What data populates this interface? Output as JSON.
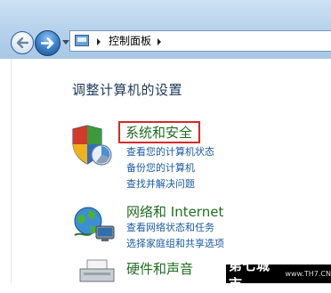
{
  "address_bar": {
    "root_label": "控制面板",
    "icon": "control-panel-icon"
  },
  "nav": {
    "back_icon": "back-arrow-icon",
    "forward_icon": "forward-arrow-icon",
    "recent_icon": "chevron-down-icon"
  },
  "page": {
    "heading": "调整计算机的设置"
  },
  "categories": [
    {
      "title": "系统和安全",
      "icon": "shield-icon",
      "links": [
        "查看您的计算机状态",
        "备份您的计算机",
        "查找并解决问题"
      ]
    },
    {
      "title": "网络和 Internet",
      "icon": "network-globe-icon",
      "links": [
        "查看网络状态和任务",
        "选择家庭组和共享选项"
      ]
    },
    {
      "title": "硬件和声音",
      "icon": "printer-icon",
      "links": []
    }
  ],
  "watermark": {
    "brand": "第七城市",
    "url": "www.TH7.CN"
  },
  "colors": {
    "category_title": "#1f6f1f",
    "link": "#1a5aa6",
    "highlight": "#d42a2a"
  }
}
